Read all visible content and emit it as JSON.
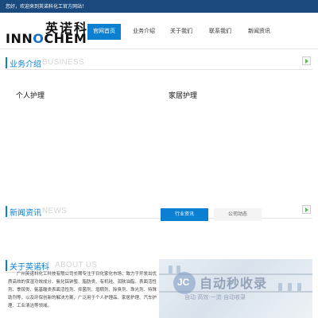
{
  "topbar": {
    "welcome": "您好，欢迎来到英诺科化工官方网站！"
  },
  "logo": {
    "cn": "英诺科",
    "en_pre": "INN",
    "en_o": "O",
    "en_post": "CHEM"
  },
  "nav": {
    "items": [
      "官网首页",
      "业务介绍",
      "关于我们",
      "联系我们",
      "新闻资讯"
    ],
    "active_index": 0
  },
  "business": {
    "title_cn": "业务介绍",
    "title_en": "BUSINESS",
    "items": [
      "个人护理",
      "家居护理"
    ]
  },
  "news": {
    "title_cn": "新闻资讯",
    "title_en": "NEWS",
    "tabs": [
      "行业资讯",
      "公司动态"
    ]
  },
  "about": {
    "title_cn": "关于英诺科",
    "title_en": "ABOUT US",
    "text": "广州英诺科化工科技有限公司长期专注于日化家化市场，致力于开发出优质高效的保湿功效成分、氨化铝铈螯、脂肪类、有机硅、润肤油脂、表面活性剂、季铵类、氨基酸类表面活性剂、抑菌剂、增稠剂、除臭剂、珠光剂、特殊助剂等，以及环保创新的解决方案，广泛用于个人护理品、家居护理、汽车护理、工业清洁等领域。"
  },
  "watermark": {
    "badge": "JC",
    "main": "自动秒收录",
    "sub": "自动·高效·一流·自动收录"
  },
  "colors": {
    "accent": "#0b7fd1",
    "topbar": "#1a4a7e",
    "arrow": "#5cb85c"
  }
}
